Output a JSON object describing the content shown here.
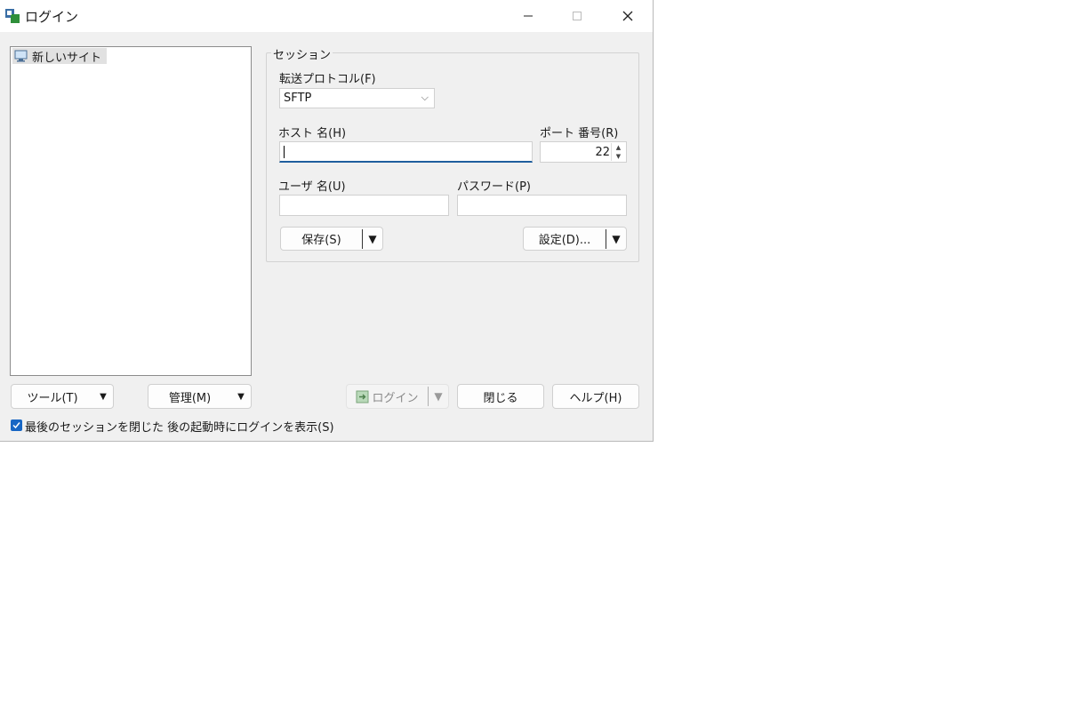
{
  "window": {
    "title": "ログイン"
  },
  "site_tree": {
    "items": [
      {
        "label": "新しいサイト",
        "icon": "monitor-icon"
      }
    ]
  },
  "session": {
    "group_label": "セッション",
    "protocol_label": "転送プロトコル(F)",
    "protocol_value": "SFTP",
    "host_label": "ホスト 名(H)",
    "host_value": "",
    "port_label": "ポート 番号(R)",
    "port_value": "22",
    "user_label": "ユーザ 名(U)",
    "user_value": "",
    "password_label": "パスワード(P)",
    "password_value": "",
    "save_label": "保存(S)",
    "settings_label": "設定(D)..."
  },
  "bottom": {
    "tools_label": "ツール(T)",
    "manage_label": "管理(M)",
    "login_label": "ログイン",
    "close_label": "閉じる",
    "help_label": "ヘルプ(H)",
    "checkbox_label": "最後のセッションを閉じた 後の起動時にログインを表示(S)",
    "checkbox_checked": true
  },
  "colors": {
    "accent": "#1766c4",
    "window_bg": "#f0f0f0"
  }
}
